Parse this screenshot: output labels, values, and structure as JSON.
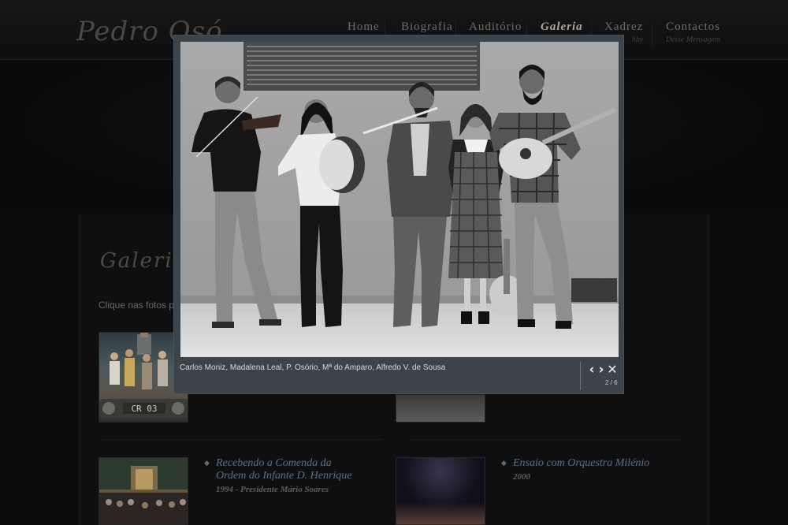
{
  "header": {
    "logo_text": "Pedro Osó",
    "nav": [
      {
        "label": "Home",
        "sub": ""
      },
      {
        "label": "Biografia",
        "sub": ""
      },
      {
        "label": "Auditório",
        "sub": ""
      },
      {
        "label": "Galeria",
        "sub": ""
      },
      {
        "label": "Xadrez",
        "sub": "hby"
      },
      {
        "label": "Contactos",
        "sub": "Deixe Mensagem"
      }
    ],
    "active_nav": "Galeria"
  },
  "page": {
    "heading": "Galeria",
    "intro": "Clique nas fotos par"
  },
  "gallery": [
    {
      "title_line1": "Recebendo a Comenda da",
      "title_line2": "Ordem do Infante D. Henrique",
      "subtitle": "1994 - Presidente Mário Soares"
    },
    {
      "title_line1": "Ensaio com Orquestra Milénio",
      "title_line2": "",
      "subtitle": "2000"
    }
  ],
  "thumb_text": "CR 03",
  "lightbox": {
    "caption": "Carlos Moniz, Madalena Leal, P. Osório, Mª do Amparo, Alfredo V. de Sousa",
    "counter": "2 / 6",
    "prev_icon": "‹",
    "next_icon": "›",
    "close_icon": "✕"
  },
  "colors": {
    "lightbox_frame": "#3c444a",
    "caption_title": "#5d7184",
    "background": "#0b0b0c"
  }
}
